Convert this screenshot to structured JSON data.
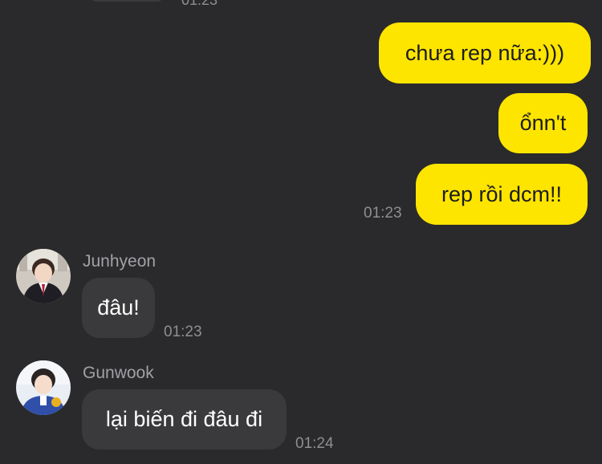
{
  "top_time_partial": "01:23",
  "messages": [
    {
      "side": "out",
      "text": "chưa rep nữa:)))"
    },
    {
      "side": "out",
      "text": "ổnn't"
    },
    {
      "side": "out",
      "text": "rep rồi dcm!!",
      "time": "01:23"
    },
    {
      "side": "in",
      "sender": "Junhyeon",
      "text": "đâu!",
      "time": "01:23"
    },
    {
      "side": "in",
      "sender": "Gunwook",
      "text": "lại biến đi đâu đi",
      "time": "01:24"
    }
  ],
  "avatars": [
    "avatar-junhyeon",
    "avatar-gunwook"
  ],
  "colors": {
    "background": "#2a2a2c",
    "outgoing_bubble": "#fee500",
    "incoming_bubble": "#3a3a3c",
    "timestamp": "#8e8e93"
  }
}
